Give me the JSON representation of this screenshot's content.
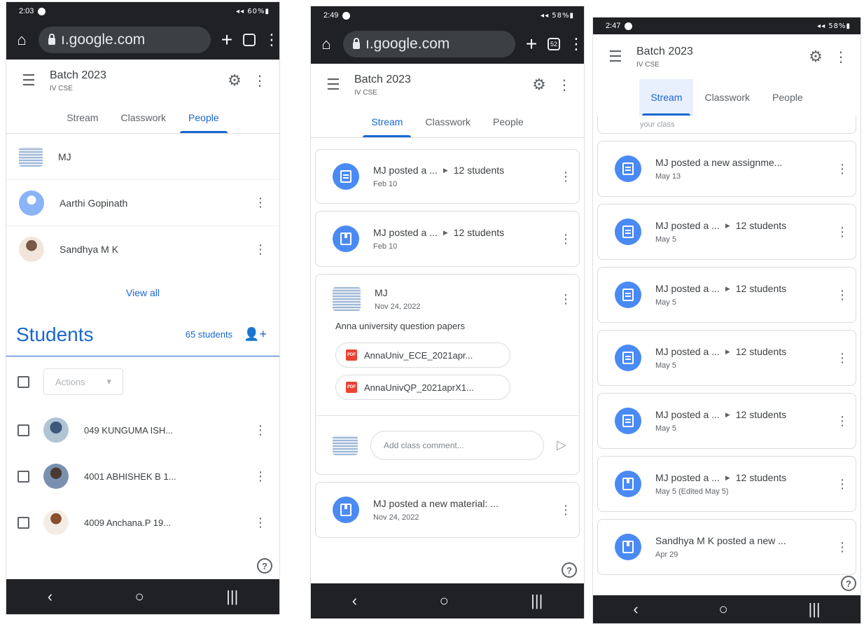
{
  "panel1": {
    "status": {
      "time": "2:03",
      "icons": "◂◂ 60%▮"
    },
    "url": "ı.google.com",
    "tabs_count": "",
    "class": {
      "title": "Batch 2023",
      "subtitle": "IV CSE"
    },
    "tabs": [
      "Stream",
      "Classwork",
      "People"
    ],
    "teachers": [
      {
        "name": "MJ"
      },
      {
        "name": "Aarthi Gopinath"
      },
      {
        "name": "Sandhya M K"
      }
    ],
    "view_all": "View all",
    "students_label": "Students",
    "students_count": "65 students",
    "actions_label": "Actions",
    "students": [
      {
        "name": "049 KUNGUMA ISH..."
      },
      {
        "name": "4001 ABHISHEK B 1..."
      },
      {
        "name": "4009 Anchana.P 19..."
      }
    ]
  },
  "panel2": {
    "status": {
      "time": "2:49",
      "icons": "◂◂ 58%▮"
    },
    "url": "ı.google.com",
    "tabs_count": "52",
    "class": {
      "title": "Batch 2023",
      "subtitle": "IV CSE"
    },
    "tabs": [
      "Stream",
      "Classwork",
      "People"
    ],
    "cards": [
      {
        "text": "MJ posted a ...",
        "audience": "12 students",
        "date": "Feb 10",
        "kind": "assign"
      },
      {
        "text": "MJ posted a ...",
        "audience": "12 students",
        "date": "Feb 10",
        "kind": "material"
      }
    ],
    "post": {
      "author": "MJ",
      "date": "Nov 24, 2022",
      "body": "Anna university question papers",
      "attachments": [
        "AnnaUniv_ECE_2021apr...",
        "AnnaUnivQP_2021aprX1..."
      ],
      "pdf_label": "PDF",
      "comment_placeholder": "Add class comment..."
    },
    "last_card": {
      "text": "MJ posted a new material: ...",
      "date": "Nov 24, 2022"
    }
  },
  "panel3": {
    "status": {
      "time": "2:47",
      "icons": "◂◂ 58%▮"
    },
    "class": {
      "title": "Batch 2023",
      "subtitle": "IV CSE"
    },
    "tabs": [
      "Stream",
      "Classwork",
      "People"
    ],
    "partial_text": "your class",
    "cards": [
      {
        "text": "MJ posted a new assignme...",
        "audience": "",
        "date": "May 13",
        "kind": "assign"
      },
      {
        "text": "MJ posted a ...",
        "audience": "12 students",
        "date": "May 5",
        "kind": "assign"
      },
      {
        "text": "MJ posted a ...",
        "audience": "12 students",
        "date": "May 5",
        "kind": "assign"
      },
      {
        "text": "MJ posted a ...",
        "audience": "12 students",
        "date": "May 5",
        "kind": "assign"
      },
      {
        "text": "MJ posted a ...",
        "audience": "12 students",
        "date": "May 5",
        "kind": "assign"
      },
      {
        "text": "MJ posted a ...",
        "audience": "12 students",
        "date": "May 5 (Edited May 5)",
        "kind": "material"
      },
      {
        "text": "Sandhya M K posted a new ...",
        "audience": "",
        "date": "Apr 29",
        "kind": "material"
      }
    ]
  },
  "help": "?",
  "colors": {
    "accent": "#1967d2",
    "icon_circle": "#4a8af4",
    "chrome": "#202124"
  }
}
